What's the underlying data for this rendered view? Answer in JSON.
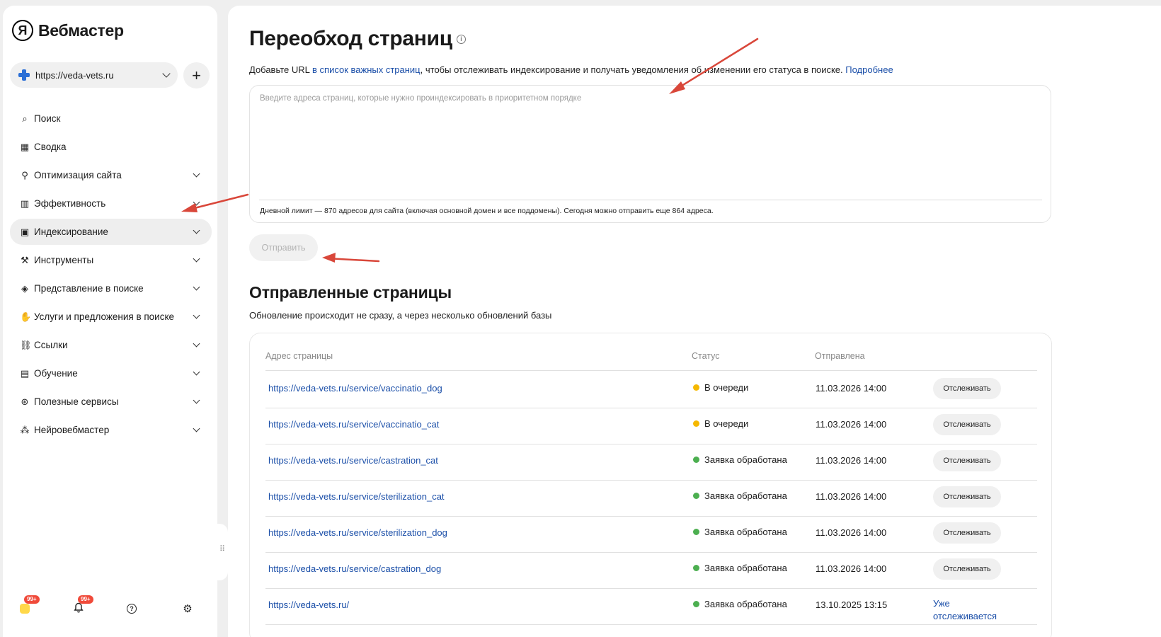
{
  "app": {
    "logo_mark": "Я",
    "logo_text": "Вебмастер"
  },
  "site": {
    "url": "https://veda-vets.ru",
    "add_label": "+"
  },
  "nav": [
    {
      "label": "Поиск",
      "icon": "⌕",
      "icon_name": "search-icon",
      "chevron": false,
      "active": false
    },
    {
      "label": "Сводка",
      "icon": "▦",
      "icon_name": "grid-icon",
      "chevron": false,
      "active": false
    },
    {
      "label": "Оптимизация сайта",
      "icon": "⚲",
      "icon_name": "sitemap-icon",
      "chevron": true,
      "active": false
    },
    {
      "label": "Эффективность",
      "icon": "▥",
      "icon_name": "bar-chart-icon",
      "chevron": true,
      "active": false
    },
    {
      "label": "Индексирование",
      "icon": "▣",
      "icon_name": "indexing-icon",
      "chevron": true,
      "active": true
    },
    {
      "label": "Инструменты",
      "icon": "⚒",
      "icon_name": "wrench-icon",
      "chevron": true,
      "active": false
    },
    {
      "label": "Представление в поиске",
      "icon": "◈",
      "icon_name": "megaphone-icon",
      "chevron": true,
      "active": false
    },
    {
      "label": "Услуги и предложения в поиске",
      "icon": "✋",
      "icon_name": "hand-icon",
      "chevron": true,
      "active": false
    },
    {
      "label": "Ссылки",
      "icon": "⛓",
      "icon_name": "link-icon",
      "chevron": true,
      "active": false
    },
    {
      "label": "Обучение",
      "icon": "▤",
      "icon_name": "book-icon",
      "chevron": true,
      "active": false
    },
    {
      "label": "Полезные сервисы",
      "icon": "⊛",
      "icon_name": "services-icon",
      "chevron": true,
      "active": false
    },
    {
      "label": "Нейровебмастер",
      "icon": "⁂",
      "icon_name": "neuro-icon",
      "chevron": true,
      "active": false
    }
  ],
  "bottom_bar": {
    "apps_badge": "99+",
    "notifications_badge": "99+",
    "help_icon": "?",
    "settings_icon": "⚙"
  },
  "page": {
    "title": "Переобход страниц",
    "info": "i",
    "intro_before": "Добавьте URL ",
    "intro_link": "в список важных страниц",
    "intro_after": ", чтобы отслеживать индексирование и получать уведомления об изменении его статуса в поиске. ",
    "intro_more": "Подробнее",
    "url_placeholder": "Введите адреса страниц, которые нужно проиндексировать в приоритетном порядке",
    "url_value": "",
    "limit_text": "Дневной лимит — 870 адресов для сайта (включая основной домен и все поддомены).  Сегодня можно отправить еще 864 адреса.",
    "submit_label": "Отправить"
  },
  "sent": {
    "title": "Отправленные страницы",
    "subtitle": "Обновление происходит не сразу, а через несколько обновлений базы",
    "columns": {
      "url": "Адрес страницы",
      "status": "Статус",
      "sent": "Отправлена"
    },
    "status_colors": {
      "queued": "#f5b800",
      "done": "#4caf50"
    },
    "rows": [
      {
        "url": "https://veda-vets.ru/service/vaccinatio_dog",
        "status": "В очереди",
        "status_type": "queued",
        "date": "11.03.2026 14:00",
        "action": "Отслеживать"
      },
      {
        "url": "https://veda-vets.ru/service/vaccinatio_cat",
        "status": "В очереди",
        "status_type": "queued",
        "date": "11.03.2026 14:00",
        "action": "Отслеживать"
      },
      {
        "url": "https://veda-vets.ru/service/castration_cat",
        "status": "Заявка обработана",
        "status_type": "done",
        "date": "11.03.2026 14:00",
        "action": "Отслеживать"
      },
      {
        "url": "https://veda-vets.ru/service/sterilization_cat",
        "status": "Заявка обработана",
        "status_type": "done",
        "date": "11.03.2026 14:00",
        "action": "Отслеживать"
      },
      {
        "url": "https://veda-vets.ru/service/sterilization_dog",
        "status": "Заявка обработана",
        "status_type": "done",
        "date": "11.03.2026 14:00",
        "action": "Отслеживать"
      },
      {
        "url": "https://veda-vets.ru/service/castration_dog",
        "status": "Заявка обработана",
        "status_type": "done",
        "date": "11.03.2026 14:00",
        "action": "Отслеживать"
      },
      {
        "url": "https://veda-vets.ru/",
        "status": "Заявка обработана",
        "status_type": "done",
        "date": "13.10.2025 13:15",
        "action": "",
        "tracked_text": "Уже отслеживается"
      }
    ]
  },
  "annotation_color": "#d9473a"
}
